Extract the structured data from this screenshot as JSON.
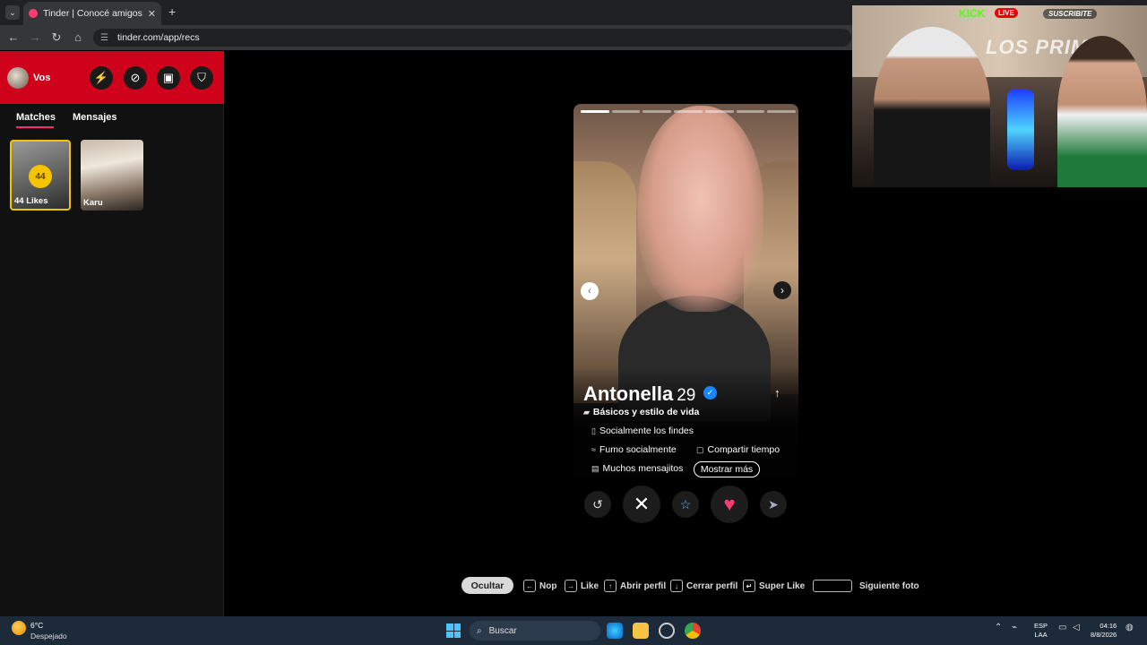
{
  "browser": {
    "tab_title": "Tinder | Conocé amigos y gente",
    "url": "tinder.com/app/recs",
    "new_tab": "+",
    "tab_close": "✕"
  },
  "sidebar": {
    "user_name": "Vos",
    "tabs": [
      "Matches",
      "Mensajes"
    ],
    "active_tab": "Matches",
    "likes_count": "44",
    "likes_label": "44 Likes",
    "match_name": "Karu"
  },
  "profile": {
    "name": "Antonella",
    "age": "29",
    "verified": true,
    "section_title": "Básicos y estilo de vida",
    "tags": [
      "Socialmente los findes",
      "Fumo socialmente",
      "Compartir tiempo",
      "Muchos mensajitos"
    ],
    "show_more": "Mostrar más",
    "photo_count": 7,
    "current_photo": 1
  },
  "actions": {
    "rewind_icon": "↺",
    "nope_icon": "✕",
    "superlike_icon": "☆",
    "like_icon": "♥",
    "boost_icon": "➤"
  },
  "shortcuts": {
    "hide": "Ocultar",
    "items": [
      {
        "key": "←",
        "label": "Nop"
      },
      {
        "key": "→",
        "label": "Like"
      },
      {
        "key": "↑",
        "label": "Abrir perfil"
      },
      {
        "key": "↓",
        "label": "Cerrar perfil"
      },
      {
        "key": "↵",
        "label": "Super Like"
      },
      {
        "key": "",
        "label": "Siguiente foto"
      }
    ]
  },
  "stream_overlay": {
    "platform": "KICK",
    "live": "LIVE",
    "subscribe": "SUSCRIBITE",
    "logo": "LOS PRIMOS"
  },
  "taskbar": {
    "temperature": "6°C",
    "weather": "Despejado",
    "search": "Buscar",
    "lang_top": "ESP",
    "lang_bottom": "LAA",
    "time": "04:16",
    "date": "8/8/2026"
  },
  "colors": {
    "brand_red": "#d0021b",
    "like_red": "#fe3c72",
    "gold": "#f5c400",
    "verified_blue": "#1786ff",
    "superlike_blue": "#6ab7ff"
  }
}
